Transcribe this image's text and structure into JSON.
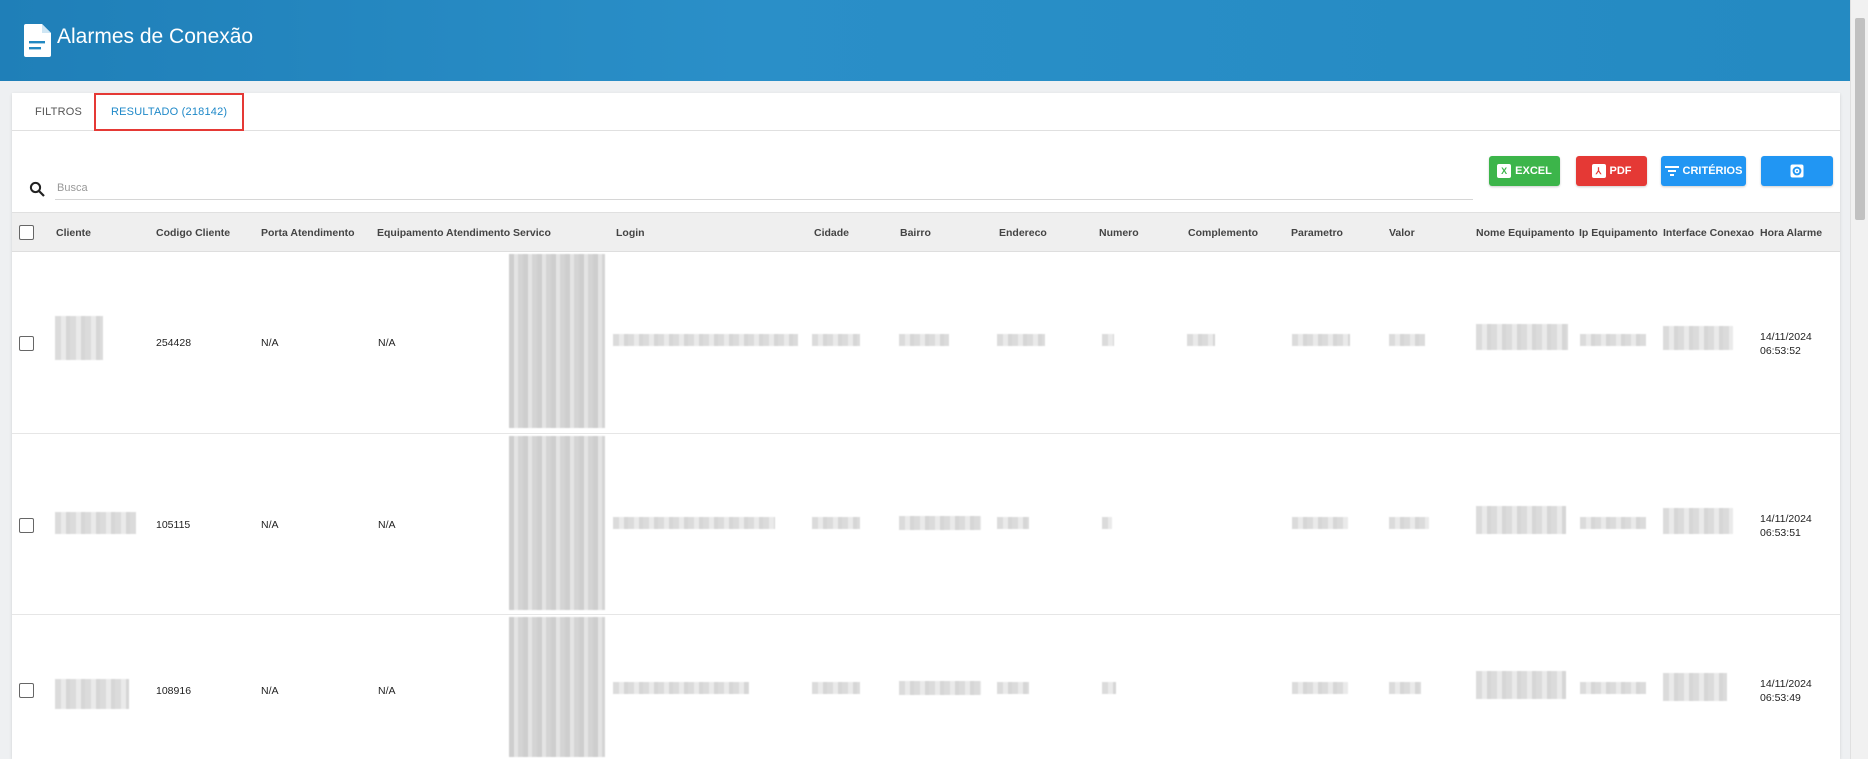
{
  "header": {
    "title": "Alarmes de Conexão",
    "icon": "document-icon"
  },
  "tabs": [
    {
      "label": "FILTROS",
      "active": false
    },
    {
      "label": "RESULTADO (218142)",
      "active": true
    }
  ],
  "search": {
    "placeholder": "Busca",
    "value": ""
  },
  "toolbar": {
    "excel_label": "EXCEL",
    "pdf_label": "PDF",
    "criterios_label": "CRITÉRIOS",
    "colors": {
      "excel": "#3cb54a",
      "pdf": "#e53935",
      "primary": "#2196f3"
    }
  },
  "table": {
    "columns": [
      "Cliente",
      "Codigo Cliente",
      "Porta Atendimento",
      "Equipamento Atendimento",
      "Servico",
      "Login",
      "Cidade",
      "Bairro",
      "Endereco",
      "Numero",
      "Complemento",
      "Parametro",
      "Valor",
      "Nome Equipamento",
      "Ip Equipamento",
      "Interface Conexao",
      "Hora Alarme"
    ],
    "rows": [
      {
        "codigo_cliente": "254428",
        "porta": "N/A",
        "equipamento": "N/A",
        "hora_date": "14/11/2024",
        "hora_time": "06:53:52"
      },
      {
        "codigo_cliente": "105115",
        "porta": "N/A",
        "equipamento": "N/A",
        "hora_date": "14/11/2024",
        "hora_time": "06:53:51"
      },
      {
        "codigo_cliente": "108916",
        "porta": "N/A",
        "equipamento": "N/A",
        "hora_date": "14/11/2024",
        "hora_time": "06:53:49"
      }
    ]
  }
}
